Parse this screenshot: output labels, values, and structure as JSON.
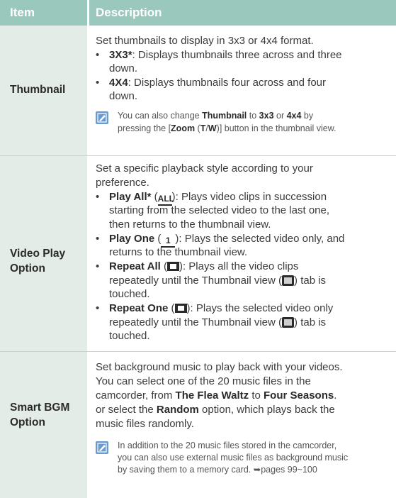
{
  "header": {
    "item": "Item",
    "description": "Description"
  },
  "rows": [
    {
      "item_lines": [
        "Thumbnail"
      ],
      "intro": "Set thumbnails to display in 3x3 or 4x4 format.",
      "bullets": [
        {
          "bold": "3X3*",
          "lines": [
            ": Displays thumbnails three across and three",
            "down."
          ]
        },
        {
          "bold": "4X4",
          "lines": [
            ": Displays thumbnails four across and four",
            "down."
          ]
        }
      ],
      "note": {
        "icon": "note-icon",
        "line1_a": "You can also change ",
        "line1_b": "Thumbnail",
        "line1_c": " to ",
        "line1_d": "3x3",
        "line1_e": " or ",
        "line1_f": "4x4",
        "line1_g": " by",
        "line2_a": "pressing the [",
        "line2_b": "Zoom",
        "line2_c": " (",
        "line2_d": "T",
        "line2_e": "/",
        "line2_f": "W",
        "line2_g": ")] button in the thumbnail view."
      }
    },
    {
      "item_lines": [
        "Video Play",
        "Option"
      ],
      "intro_lines": [
        "Set a specific playback style according to your",
        "preference."
      ],
      "bullets": [
        {
          "bold": "Play All*",
          "icon": "play-all-icon",
          "icon_text": "ALL",
          "lines": [
            "): Plays video clips in succession",
            "starting from the selected video to the last one,",
            "then returns to the thumbnail view."
          ]
        },
        {
          "bold": "Play One",
          "icon": "play-one-icon",
          "icon_text": "1",
          "lines": [
            "): Plays the selected video only, and",
            "returns to the thumbnail view."
          ]
        },
        {
          "bold": "Repeat All",
          "icon": "repeat-all-icon",
          "lines": [
            "): Plays all the video clips",
            "repeatedly until the Thumbnail view (",
            ") tab is",
            "touched."
          ]
        },
        {
          "bold": "Repeat One",
          "icon": "repeat-one-icon",
          "lines": [
            "): Plays the selected video only",
            "repeatedly until the Thumbnail view (",
            ") tab is",
            "touched."
          ]
        }
      ]
    },
    {
      "item_lines": [
        "Smart BGM",
        "Option"
      ],
      "lines": [
        "Set background music to play back with your videos.",
        "You can select one of the 20 music files in the",
        "camcorder, from ",
        "The Flea Waltz",
        " to ",
        "Four Seasons",
        ".",
        "or select the ",
        "Random",
        " option, which plays back the",
        "music files randomly."
      ],
      "note_lines": [
        "In addition to the 20 music files stored in the camcorder,",
        "you can also use external music files as background music",
        "by saving them to a memory card. ➥pages 99~100"
      ]
    }
  ]
}
